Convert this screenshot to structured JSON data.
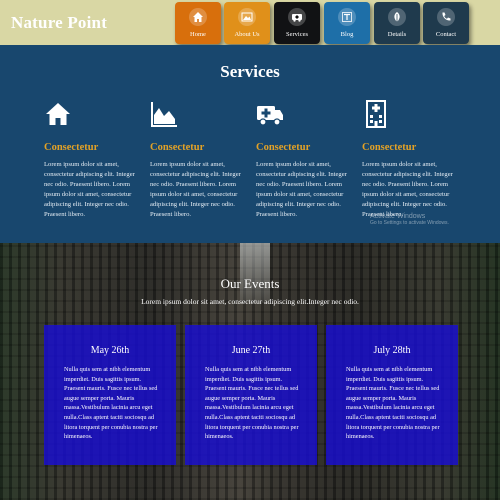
{
  "brand": "Nature Point",
  "nav": [
    {
      "label": "Home",
      "icon": "home-icon"
    },
    {
      "label": "About Us",
      "icon": "image-icon"
    },
    {
      "label": "Services",
      "icon": "ambulance-icon"
    },
    {
      "label": "Blog",
      "icon": "text-icon"
    },
    {
      "label": "Details",
      "icon": "leaf-icon"
    },
    {
      "label": "Contact",
      "icon": "phone-icon"
    }
  ],
  "services": {
    "title": "Services",
    "items": [
      {
        "heading": "Consectetur",
        "icon": "home-icon",
        "text": "Lorem ipsum dolor sit amet, consectetur adipiscing elit. Integer nec odio. Praesent libero. Lorem ipsum dolor sit amet, consectetur adipiscing elit. Integer nec odio. Praesent libero."
      },
      {
        "heading": "Consectetur",
        "icon": "area-chart-icon",
        "text": "Lorem ipsum dolor sit amet, consectetur adipiscing elit. Integer nec odio. Praesent libero. Lorem ipsum dolor sit amet, consectetur adipiscing elit. Integer nec odio. Praesent libero."
      },
      {
        "heading": "Consectetur",
        "icon": "ambulance-icon",
        "text": "Lorem ipsum dolor sit amet, consectetur adipiscing elit. Integer nec odio. Praesent libero. Lorem ipsum dolor sit amet, consectetur adipiscing elit. Integer nec odio. Praesent libero."
      },
      {
        "heading": "Consectetur",
        "icon": "hospital-icon",
        "text": "Lorem ipsum dolor sit amet, consectetur adipiscing elit. Integer nec odio. Praesent libero. Lorem ipsum dolor sit amet, consectetur adipiscing elit. Integer nec odio. Praesent libero."
      }
    ]
  },
  "watermark": {
    "line1": "Activate Windows",
    "line2": "Go to Settings to activate Windows."
  },
  "events": {
    "title": "Our Events",
    "subtitle": "Lorem ipsum dolor sit amet, consectetur adipiscing elit.Integer nec odio.",
    "cards": [
      {
        "date": "May 26th",
        "text": "Nulla quis sem at nibh elementum imperdiet. Duis sagittis ipsum. Praesent mauris. Fusce nec tellus sed augue semper porta. Mauris massa.Vestibulum lacinia arcu eget nulla.Class aptent taciti sociosqu ad litora torquent per conubia nostra per himenaeos."
      },
      {
        "date": "June 27th",
        "text": "Nulla quis sem at nibh elementum imperdiet. Duis sagittis ipsum. Praesent mauris. Fusce nec tellus sed augue semper porta. Mauris massa.Vestibulum lacinia arcu eget nulla.Class aptent taciti sociosqu ad litora torquent per conubia nostra per himenaeos."
      },
      {
        "date": "July 28th",
        "text": "Nulla quis sem at nibh elementum imperdiet. Duis sagittis ipsum. Praesent mauris. Fusce nec tellus sed augue semper porta. Mauris massa.Vestibulum lacinia arcu eget nulla.Class aptent taciti sociosqu ad litora torquent per conubia nostra per himenaeos."
      }
    ]
  },
  "colors": {
    "header_bg": "#d9d7a4",
    "services_bg": "#18476e",
    "accent": "#e3a226",
    "card_bg": "#180ed2"
  }
}
